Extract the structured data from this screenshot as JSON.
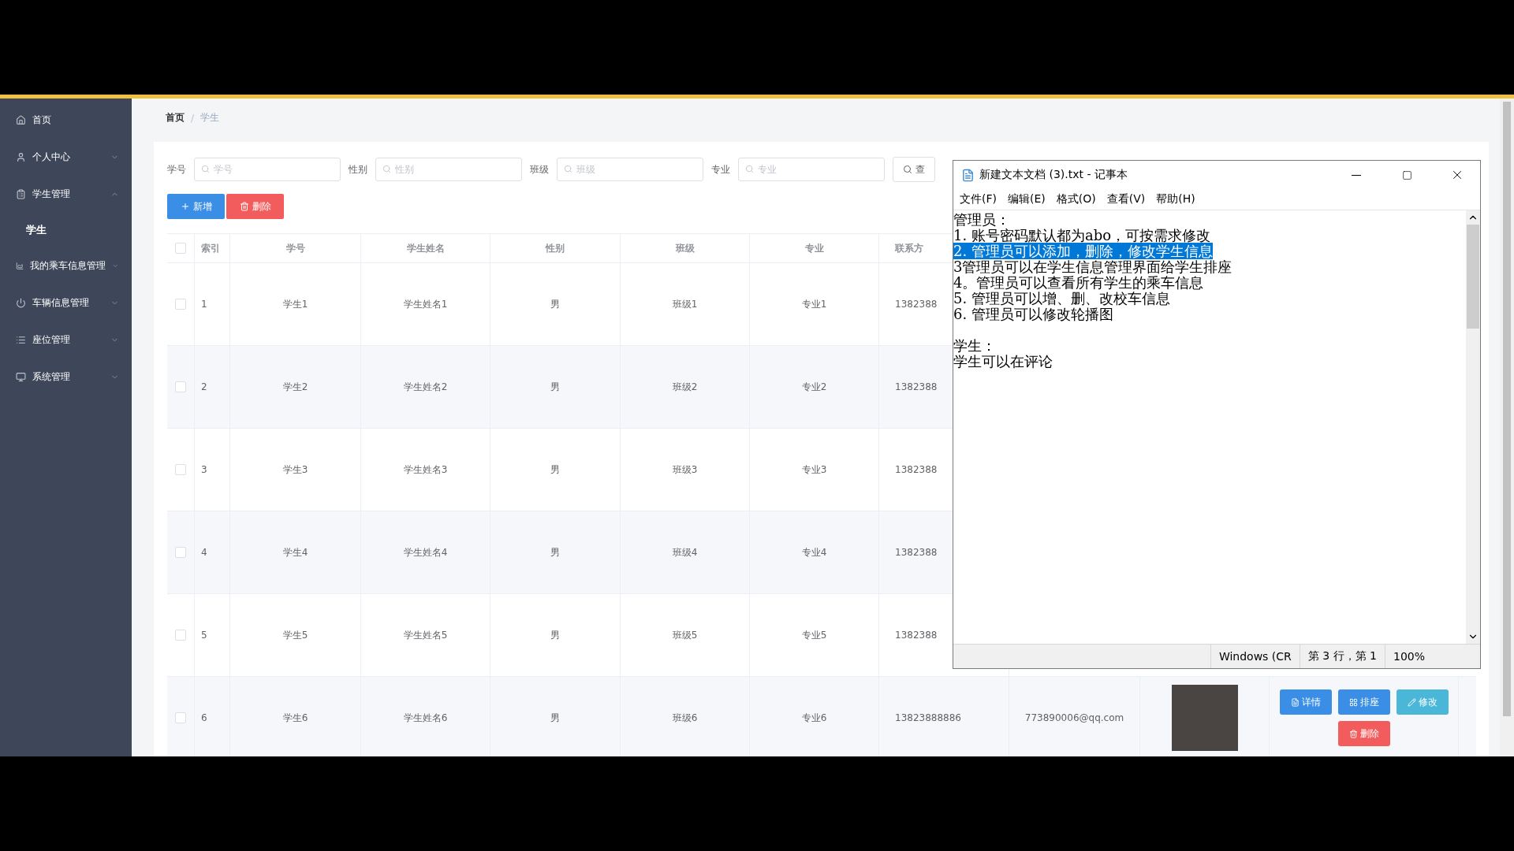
{
  "sidebar": {
    "items": [
      {
        "label": "首页",
        "kind": "home"
      },
      {
        "label": "个人中心",
        "kind": "user",
        "expanded": false
      },
      {
        "label": "学生管理",
        "kind": "clipboard",
        "expanded": true,
        "children": [
          {
            "label": "学生",
            "selected": true
          }
        ]
      },
      {
        "label": "我的乘车信息管理",
        "kind": "chart",
        "expanded": false
      },
      {
        "label": "车辆信息管理",
        "kind": "power",
        "expanded": false
      },
      {
        "label": "座位管理",
        "kind": "list",
        "expanded": false
      },
      {
        "label": "系统管理",
        "kind": "monitor",
        "expanded": false
      }
    ]
  },
  "breadcrumb": {
    "items": [
      "首页",
      "学生"
    ],
    "separator": "/"
  },
  "search": {
    "fields": [
      {
        "label": "学号",
        "placeholder": "学号"
      },
      {
        "label": "性别",
        "placeholder": "性别"
      },
      {
        "label": "班级",
        "placeholder": "班级"
      },
      {
        "label": "专业",
        "placeholder": "专业"
      }
    ],
    "button": "查"
  },
  "actions": [
    {
      "label": "新增",
      "kind": "add"
    },
    {
      "label": "删除",
      "kind": "delete"
    }
  ],
  "table": {
    "select_all_checked": false,
    "columns": [
      "索引",
      "学号",
      "学生姓名",
      "性别",
      "班级",
      "专业",
      "联系方"
    ],
    "rows": [
      {
        "checked": false,
        "cells": [
          "1",
          "学生1",
          "学生姓名1",
          "男",
          "班级1",
          "专业1",
          "1382388"
        ]
      },
      {
        "checked": false,
        "cells": [
          "2",
          "学生2",
          "学生姓名2",
          "男",
          "班级2",
          "专业2",
          "1382388"
        ]
      },
      {
        "checked": false,
        "cells": [
          "3",
          "学生3",
          "学生姓名3",
          "男",
          "班级3",
          "专业3",
          "1382388"
        ]
      },
      {
        "checked": false,
        "cells": [
          "4",
          "学生4",
          "学生姓名4",
          "男",
          "班级4",
          "专业4",
          "1382388"
        ]
      },
      {
        "checked": false,
        "cells": [
          "5",
          "学生5",
          "学生姓名5",
          "男",
          "班级5",
          "专业5",
          "1382388"
        ]
      },
      {
        "checked": false,
        "cells": [
          "6",
          "学生6",
          "学生姓名6",
          "男",
          "班级6",
          "专业6",
          "13823888886",
          "773890006@qq.com"
        ],
        "photo": true,
        "buttons": [
          {
            "label": "详情",
            "kind": "detail"
          },
          {
            "label": "排座",
            "kind": "seat"
          },
          {
            "label": "修改",
            "kind": "edit"
          },
          {
            "label": "删除",
            "kind": "delete"
          }
        ]
      }
    ]
  },
  "notepad": {
    "title": "新建文本文档 (3).txt - 记事本",
    "menu": [
      "文件(F)",
      "编辑(E)",
      "格式(O)",
      "查看(V)",
      "帮助(H)"
    ],
    "lines": [
      {
        "kind": "text",
        "text": "管理员：",
        "selected": false
      },
      {
        "kind": "text",
        "text": "1. 账号密码默认都为abo，可按需求修改",
        "selected": false
      },
      {
        "kind": "text",
        "text": "2. 管理员可以添加，删除，修改学生信息",
        "selected": true
      },
      {
        "kind": "text",
        "text": "3管理员可以在学生信息管理界面给学生排座",
        "selected": false
      },
      {
        "kind": "text",
        "text": "4。管理员可以查看所有学生的乘车信息",
        "selected": false
      },
      {
        "kind": "text",
        "text": "5. 管理员可以增、删、改校车信息",
        "selected": false
      },
      {
        "kind": "text",
        "text": "6. 管理员可以修改轮播图",
        "selected": false
      },
      {
        "kind": "blank"
      },
      {
        "kind": "text",
        "text": "学生：",
        "selected": false
      },
      {
        "kind": "text",
        "text": "学生可以在评论",
        "selected": false
      }
    ],
    "status": [
      "Windows (CR",
      "第 3 行，第 1",
      "100%"
    ]
  }
}
